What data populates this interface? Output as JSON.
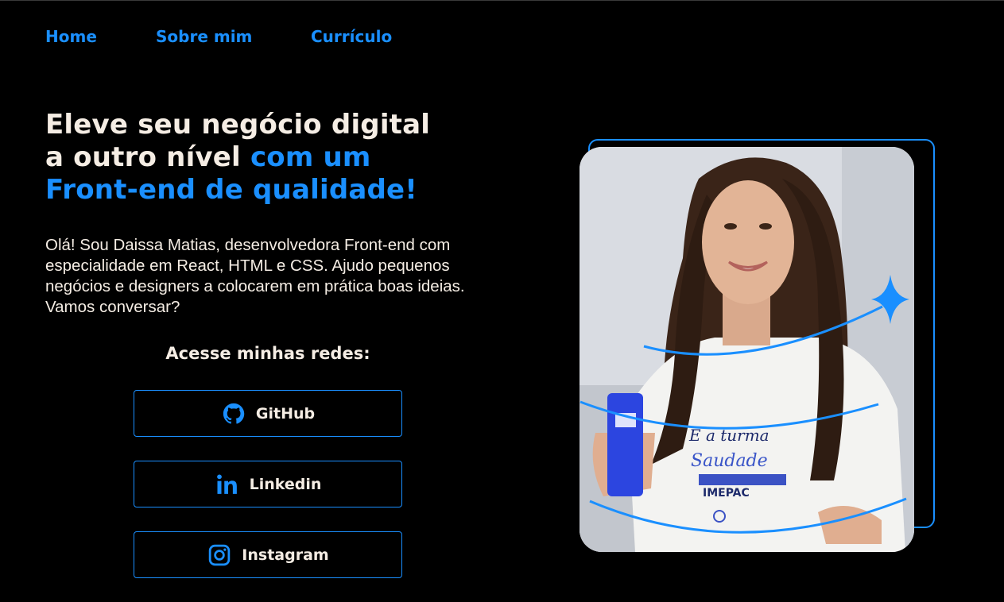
{
  "nav": {
    "items": [
      {
        "label": "Home"
      },
      {
        "label": "Sobre mim"
      },
      {
        "label": "Currículo"
      }
    ]
  },
  "hero": {
    "headline_line1": "Eleve seu negócio digital",
    "headline_line2_plain": "a outro nível ",
    "headline_line2_accent": "com um",
    "headline_line3_accent": "Front-end de qualidade!",
    "intro": "Olá! Sou Daissa Matias, desenvolvedora Front-end com especialidade em React, HTML e CSS. Ajudo pequenos negócios e designers a colocarem em prática boas ideias. Vamos conversar?"
  },
  "social": {
    "title": "Acesse minhas redes:",
    "buttons": [
      {
        "label": "GitHub",
        "icon": "github-icon"
      },
      {
        "label": "Linkedin",
        "icon": "linkedin-icon"
      },
      {
        "label": "Instagram",
        "icon": "instagram-icon"
      }
    ]
  },
  "photo": {
    "icon": "profile-photo"
  },
  "colors": {
    "background": "#000000",
    "accent": "#1a8fff",
    "text": "#f5ede4"
  }
}
